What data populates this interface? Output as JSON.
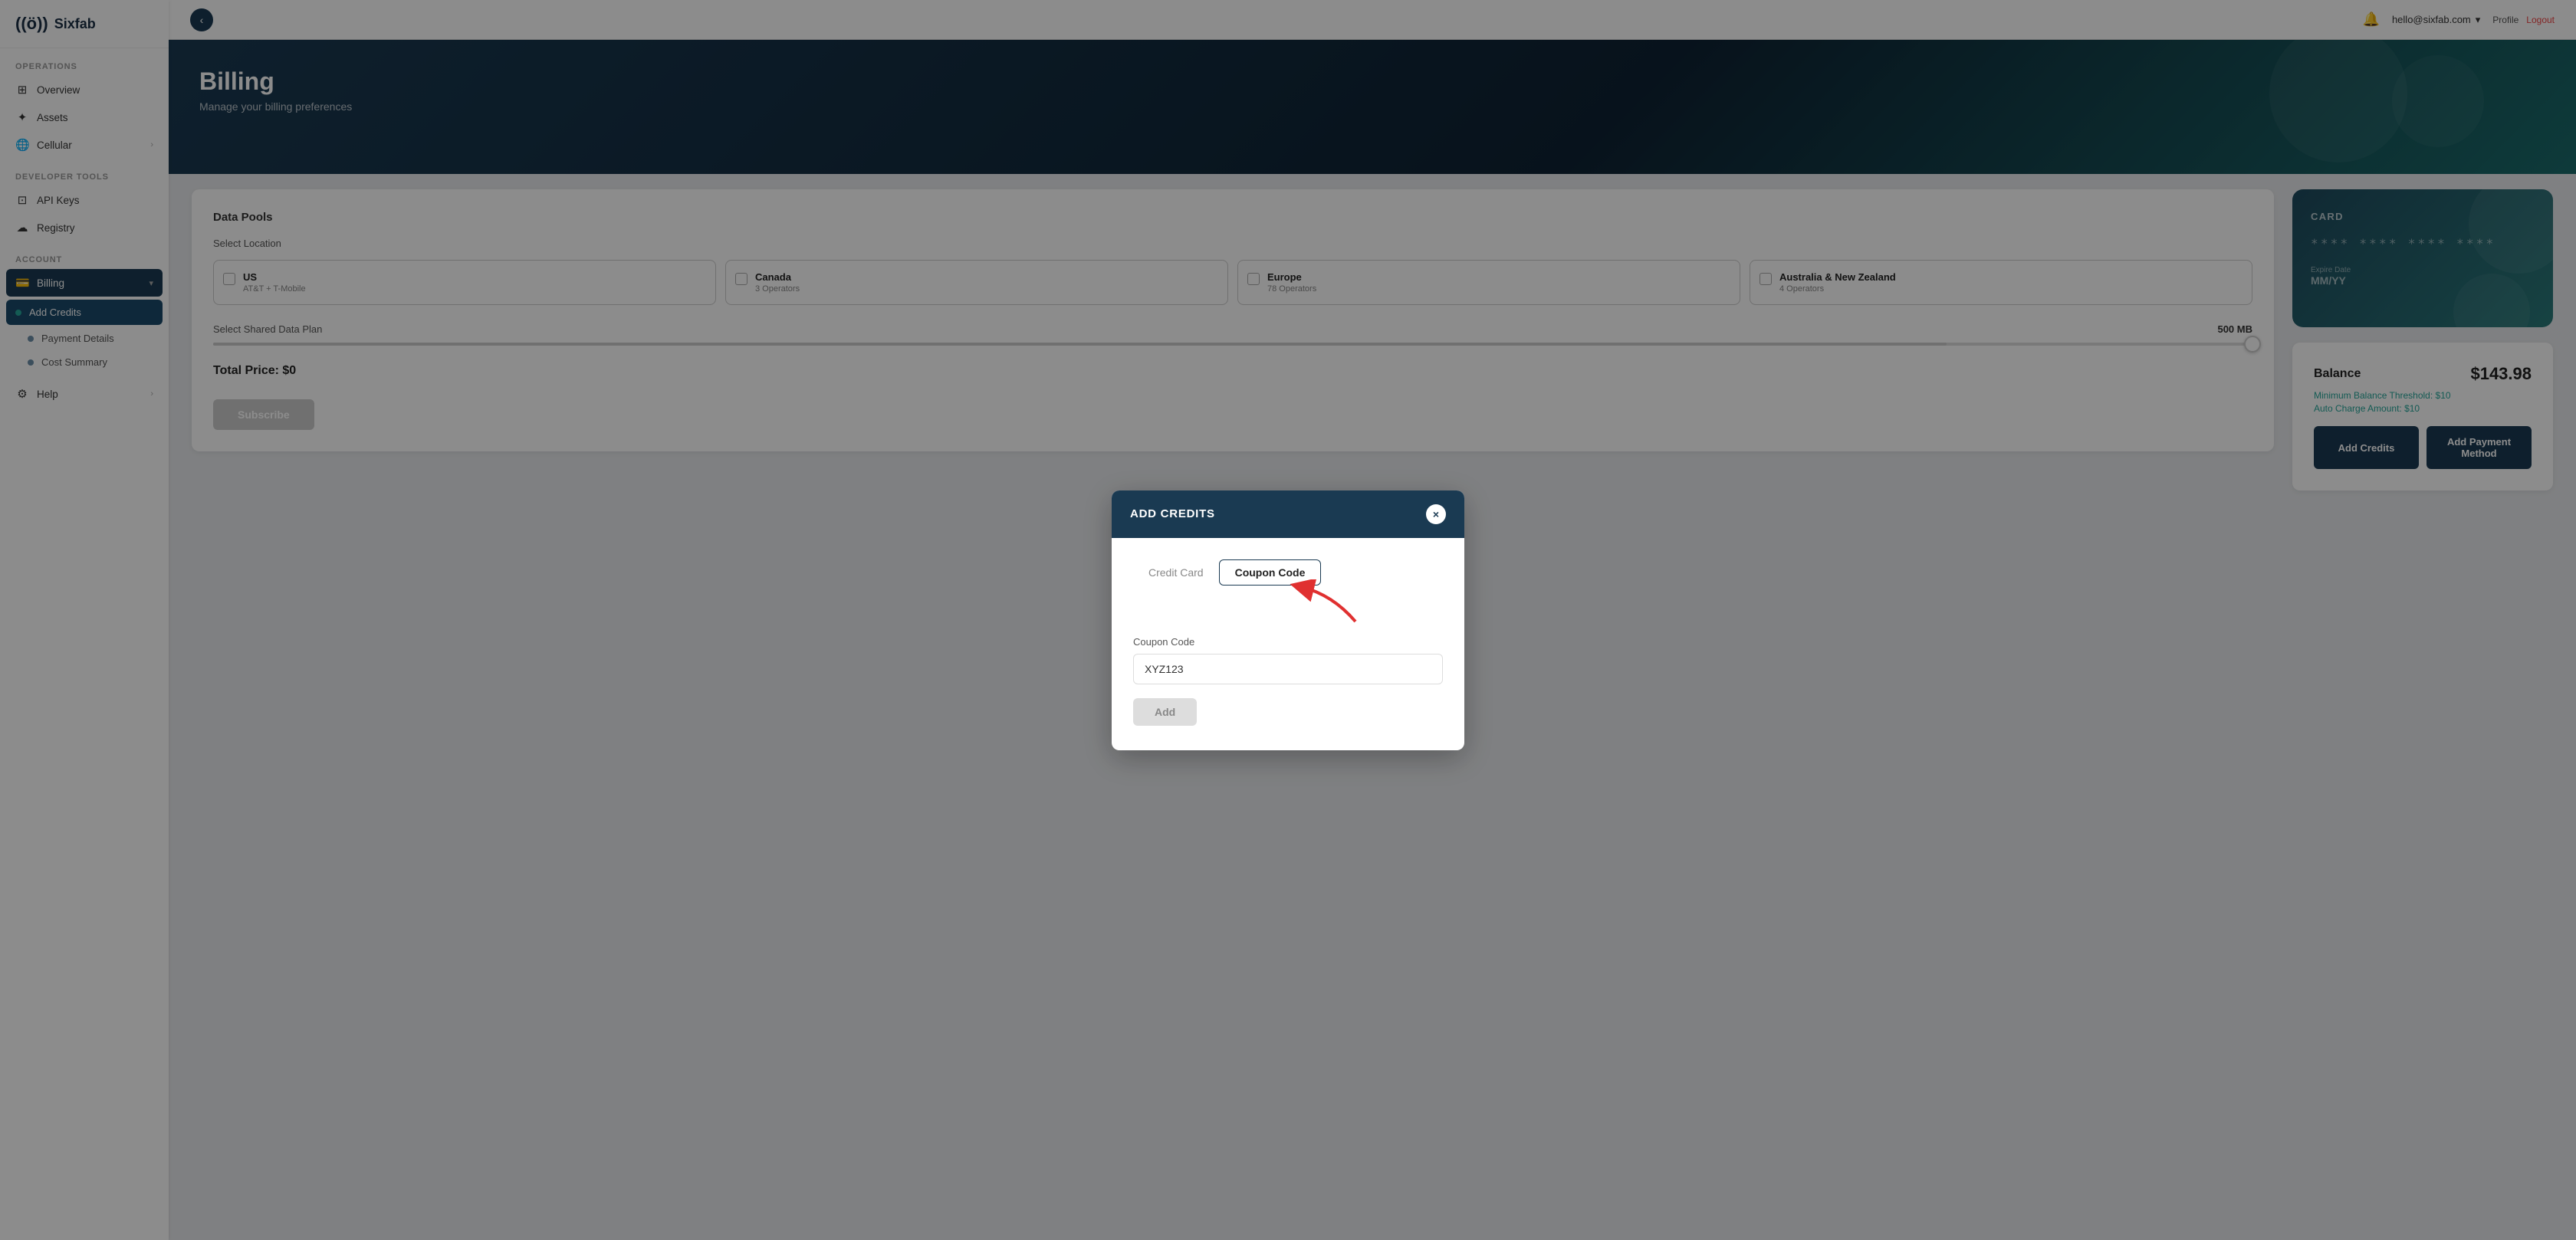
{
  "brand": {
    "logo_icon": "((ö))",
    "logo_name": "Sixfab"
  },
  "sidebar": {
    "sections": [
      {
        "label": "Operations",
        "items": [
          {
            "id": "overview",
            "label": "Overview",
            "icon": "⊞",
            "active": false
          },
          {
            "id": "assets",
            "label": "Assets",
            "icon": "✦",
            "active": false
          },
          {
            "id": "cellular",
            "label": "Cellular",
            "icon": "🌐",
            "active": false,
            "has_arrow": true
          }
        ]
      },
      {
        "label": "Developer Tools",
        "items": [
          {
            "id": "api-keys",
            "label": "API Keys",
            "icon": "⊡",
            "active": false
          },
          {
            "id": "registry",
            "label": "Registry",
            "icon": "☁",
            "active": false
          }
        ]
      },
      {
        "label": "Account",
        "items": [
          {
            "id": "billing",
            "label": "Billing",
            "icon": "💳",
            "active": true,
            "has_arrow": true
          },
          {
            "id": "add-credits",
            "label": "Add Credits",
            "sub": true,
            "active": true
          },
          {
            "id": "payment-details",
            "label": "Payment Details",
            "sub": true
          },
          {
            "id": "cost-summary",
            "label": "Cost Summary",
            "sub": true
          }
        ]
      },
      {
        "label": "",
        "items": [
          {
            "id": "help",
            "label": "Help",
            "icon": "⚙",
            "has_arrow": true
          }
        ]
      }
    ]
  },
  "topbar": {
    "user_email": "hello@sixfab.com",
    "profile_link": "Profile",
    "logout_link": "Logout"
  },
  "billing_page": {
    "title": "Billing",
    "subtitle": "Manage your billing preferences",
    "data_pools_label": "Data Pools",
    "select_location_label": "Select Location",
    "locations": [
      {
        "name": "US",
        "sub": "AT&T + T-Mobile"
      },
      {
        "name": "Canada",
        "sub": "3 Operators"
      },
      {
        "name": "Europe",
        "sub": "78 Operators"
      },
      {
        "name": "Australia & New Zealand",
        "sub": "4 Operators"
      }
    ],
    "select_plan_label": "Select Shared Data Plan",
    "plan_value": "500 MB",
    "total_price": "Total Price: $0",
    "subscribe_btn": "Subscribe"
  },
  "balance_card": {
    "card_label": "CARD",
    "card_numbers": [
      "****",
      "****",
      "****",
      "****"
    ],
    "expire_label": "Expire Date",
    "expire_value": "MM/YY",
    "balance_label": "Balance",
    "balance_value": "$143.98",
    "min_threshold": "Minimum Balance Threshold: $10",
    "auto_charge": "Auto Charge Amount: $10",
    "add_credits_btn": "Add Credits",
    "add_payment_btn": "Add Payment Method"
  },
  "modal": {
    "title": "ADD CREDITS",
    "close_label": "×",
    "tab_credit_card": "Credit Card",
    "tab_coupon_code": "Coupon Code",
    "active_tab": "coupon",
    "coupon_label": "Coupon Code",
    "coupon_placeholder": "XYZ123",
    "coupon_value": "XYZ123",
    "add_btn": "Add"
  }
}
